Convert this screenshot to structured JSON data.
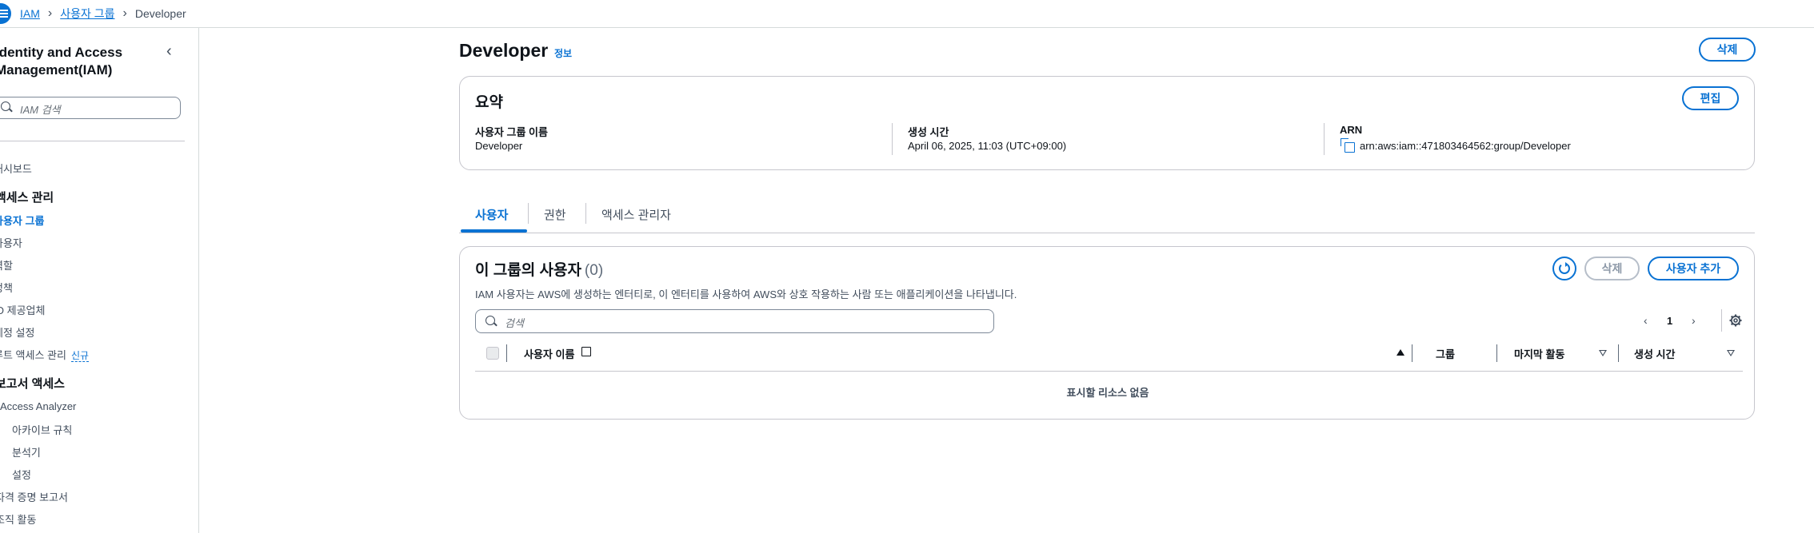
{
  "breadcrumb": {
    "items": [
      "IAM",
      "사용자 그룹"
    ],
    "current": "Developer"
  },
  "sidebar": {
    "title": "Identity and Access Management(IAM)",
    "search_placeholder": "IAM 검색",
    "items": [
      {
        "label": "대시보드",
        "kind": "item"
      },
      {
        "label": "액세스 관리",
        "kind": "section"
      },
      {
        "label": "사용자 그룹",
        "kind": "active"
      },
      {
        "label": "사용자",
        "kind": "item"
      },
      {
        "label": "역할",
        "kind": "item"
      },
      {
        "label": "정책",
        "kind": "item"
      },
      {
        "label": "ID 제공업체",
        "kind": "item"
      },
      {
        "label": "계정 설정",
        "kind": "item"
      },
      {
        "label": "루트 액세스 관리",
        "kind": "item",
        "badge": "신규"
      },
      {
        "label": "보고서 액세스",
        "kind": "section"
      },
      {
        "label": "Access Analyzer",
        "kind": "item"
      },
      {
        "label": "아카이브 규칙",
        "kind": "sub"
      },
      {
        "label": "분석기",
        "kind": "sub"
      },
      {
        "label": "설정",
        "kind": "sub"
      },
      {
        "label": "자격 증명 보고서",
        "kind": "item"
      },
      {
        "label": "조직 활동",
        "kind": "item"
      }
    ]
  },
  "page": {
    "title": "Developer",
    "info": "정보",
    "delete_label": "삭제"
  },
  "summary": {
    "title": "요약",
    "edit_label": "편집",
    "name_label": "사용자 그룹 이름",
    "name_value": "Developer",
    "created_label": "생성 시간",
    "created_value": "April 06, 2025, 11:03 (UTC+09:00)",
    "arn_label": "ARN",
    "arn_value": "arn:aws:iam::471803464562:group/Developer"
  },
  "tabs": [
    "사용자",
    "권한",
    "액세스 관리자"
  ],
  "users_panel": {
    "title": "이 그룹의 사용자",
    "count": "(0)",
    "description": "IAM 사용자는 AWS에 생성하는 엔터티로, 이 엔터티를 사용하여 AWS와 상호 작용하는 사람 또는 애플리케이션을 나타냅니다.",
    "delete_label": "삭제",
    "add_label": "사용자 추가",
    "search_placeholder": "검색",
    "page_number": "1",
    "columns": [
      "사용자 이름",
      "그룹",
      "마지막 활동",
      "생성 시간"
    ],
    "empty_message": "표시할 리소스 없음"
  },
  "colors": {
    "accent": "#0972d3",
    "text": "#0f141a",
    "muted": "#414d5c",
    "border": "#c6c6cd"
  }
}
